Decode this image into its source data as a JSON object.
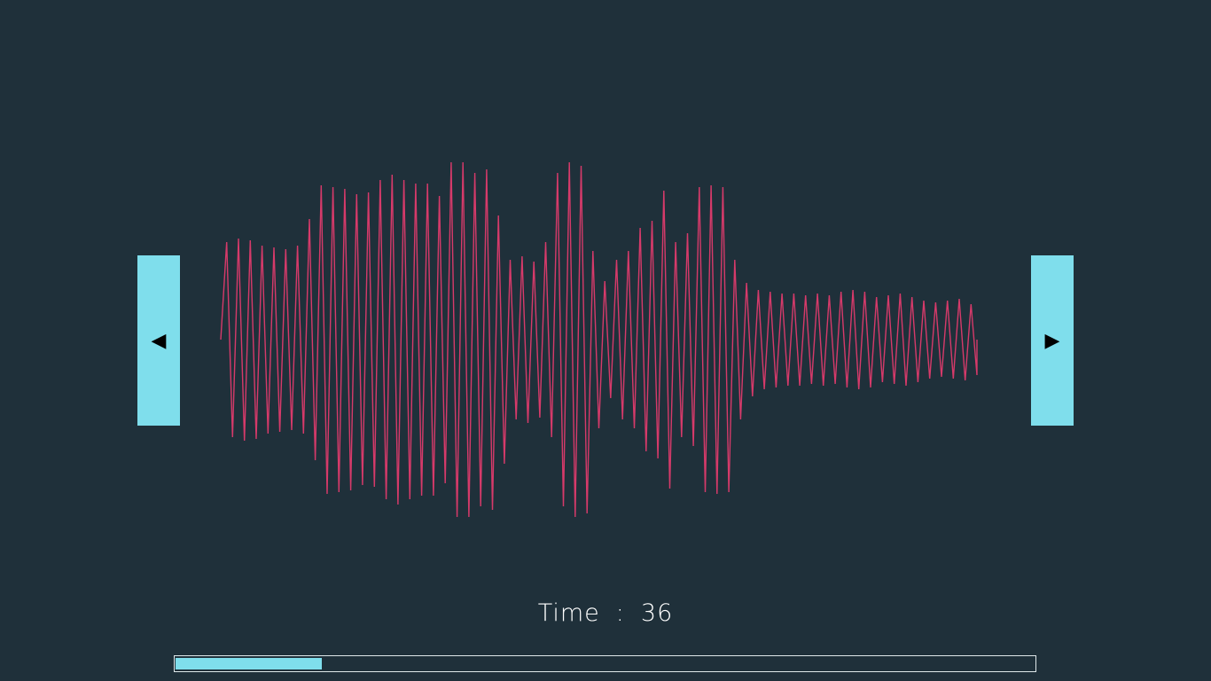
{
  "nav": {
    "prev_icon": "triangle-left-icon",
    "next_icon": "triangle-right-icon",
    "prev_glyph": "◀",
    "next_glyph": "▶"
  },
  "time": {
    "label": "Time",
    "separator": ":",
    "value": "36"
  },
  "progress": {
    "fraction": 0.17
  },
  "colors": {
    "background": "#1f303a",
    "accent": "#7fdeec",
    "wave": "#d63a6a",
    "text": "#ffffff"
  },
  "waveform": {
    "amplitudes": [
      0.55,
      0.57,
      0.56,
      0.53,
      0.52,
      0.51,
      0.53,
      0.68,
      0.87,
      0.86,
      0.85,
      0.82,
      0.83,
      0.9,
      0.93,
      0.9,
      0.88,
      0.88,
      0.81,
      1.0,
      1.0,
      0.94,
      0.96,
      0.7,
      0.45,
      0.47,
      0.44,
      0.55,
      0.94,
      1.0,
      0.98,
      0.5,
      0.33,
      0.45,
      0.5,
      0.63,
      0.67,
      0.84,
      0.55,
      0.6,
      0.86,
      0.87,
      0.86,
      0.45,
      0.32,
      0.28,
      0.27,
      0.26,
      0.26,
      0.25,
      0.26,
      0.25,
      0.27,
      0.28,
      0.27,
      0.24,
      0.25,
      0.26,
      0.24,
      0.22,
      0.21,
      0.22,
      0.23,
      0.2
    ]
  }
}
